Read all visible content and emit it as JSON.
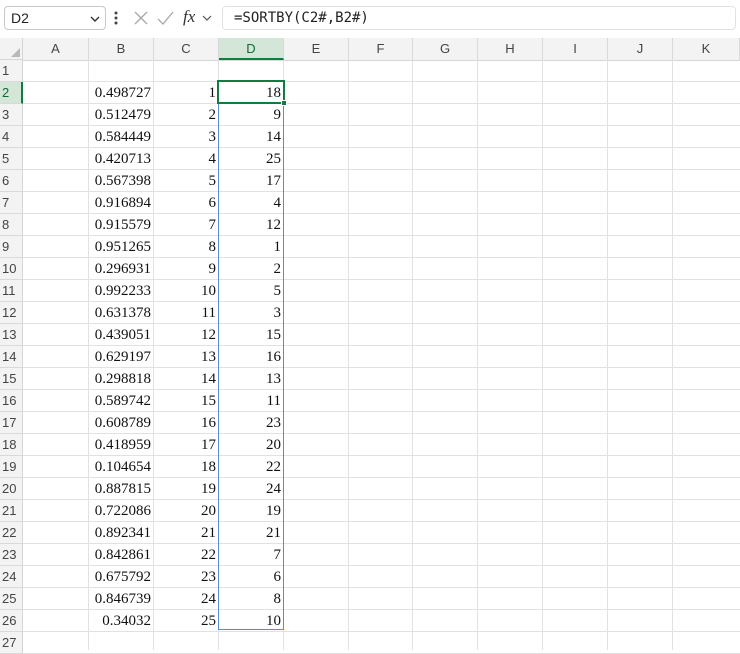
{
  "formula_bar": {
    "name_box": "D2",
    "formula": "=SORTBY(C2#,B2#)"
  },
  "icons": [
    "chevron-down-icon",
    "more-options-icon",
    "cancel-icon",
    "enter-icon",
    "insert-function-icon"
  ],
  "fx_label": "fx",
  "columns": [
    "A",
    "B",
    "C",
    "D",
    "E",
    "F",
    "G",
    "H",
    "I",
    "J",
    "K"
  ],
  "rows": [
    "1",
    "2",
    "3",
    "4",
    "5",
    "6",
    "7",
    "8",
    "9",
    "10",
    "11",
    "12",
    "13",
    "14",
    "15",
    "16",
    "17",
    "18",
    "19",
    "20",
    "21",
    "22",
    "23",
    "24",
    "25",
    "26",
    "27"
  ],
  "active_cell": "D2",
  "selection_color": "#107c41",
  "spill_color": "#5b8bd6",
  "cells": {
    "B": [
      "0.498727",
      "0.512479",
      "0.584449",
      "0.420713",
      "0.567398",
      "0.916894",
      "0.915579",
      "0.951265",
      "0.296931",
      "0.992233",
      "0.631378",
      "0.439051",
      "0.629197",
      "0.298818",
      "0.589742",
      "0.608789",
      "0.418959",
      "0.104654",
      "0.887815",
      "0.722086",
      "0.892341",
      "0.842861",
      "0.675792",
      "0.846739",
      "0.34032"
    ],
    "C": [
      "1",
      "2",
      "3",
      "4",
      "5",
      "6",
      "7",
      "8",
      "9",
      "10",
      "11",
      "12",
      "13",
      "14",
      "15",
      "16",
      "17",
      "18",
      "19",
      "20",
      "21",
      "22",
      "23",
      "24",
      "25"
    ],
    "D": [
      "18",
      "9",
      "14",
      "25",
      "17",
      "4",
      "12",
      "1",
      "2",
      "5",
      "3",
      "15",
      "16",
      "13",
      "11",
      "23",
      "20",
      "22",
      "24",
      "19",
      "21",
      "7",
      "6",
      "8",
      "10"
    ]
  }
}
